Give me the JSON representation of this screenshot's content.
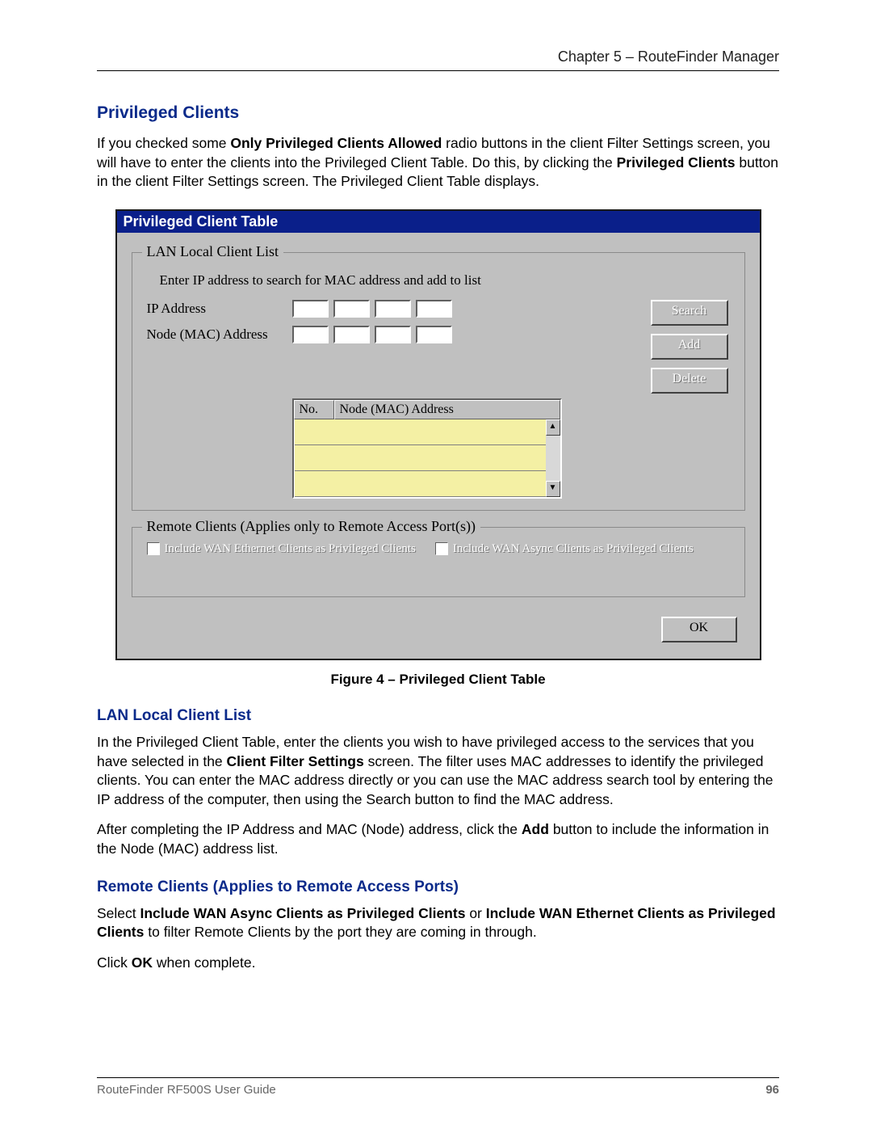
{
  "header": {
    "chapter": "Chapter 5 – RouteFinder Manager"
  },
  "section": {
    "title": "Privileged Clients",
    "intro_pre": "If you checked some ",
    "intro_bold1": "Only Privileged Clients Allowed",
    "intro_mid": " radio buttons in the client Filter Settings screen, you will have to enter the clients into the Privileged Client Table. Do this, by clicking the ",
    "intro_bold2": "Privileged Clients",
    "intro_post": " button in the client Filter Settings screen. The Privileged Client Table displays."
  },
  "dialog": {
    "title": "Privileged Client Table",
    "group_lan": {
      "legend": "LAN Local Client List",
      "instruction": "Enter IP address to search for MAC address and add to list",
      "ip_label": "IP Address",
      "mac_label": "Node (MAC) Address",
      "buttons": {
        "search": "Search",
        "add": "Add",
        "delete": "Delete"
      },
      "list_headers": {
        "no": "No.",
        "mac": "Node (MAC) Address"
      }
    },
    "group_remote": {
      "legend": "Remote Clients (Applies only to Remote Access Port(s))",
      "check_ethernet": "Include WAN Ethernet Clients as Privileged Clients",
      "check_async": "Include WAN Async Clients as Privileged Clients"
    },
    "ok": "OK"
  },
  "caption": "Figure 4 – Privileged Client Table",
  "lan_section": {
    "title": "LAN Local Client List",
    "p1_pre": "In the Privileged Client Table, enter the clients you wish to have privileged access to the services that you have selected in the ",
    "p1_bold": "Client Filter Settings",
    "p1_post": " screen. The filter uses MAC addresses to identify the privileged clients. You can enter the MAC address directly or you can use the MAC address search tool by entering the IP address of the computer, then using the Search button to find the MAC address.",
    "p2_pre": "After completing the IP Address and MAC (Node) address, click the ",
    "p2_bold": "Add",
    "p2_post": " button to include the information in the Node (MAC) address list."
  },
  "remote_section": {
    "title": "Remote Clients (Applies to Remote Access Ports)",
    "p_pre": "Select ",
    "p_bold1": "Include WAN Async Clients as Privileged Clients",
    "p_mid": " or ",
    "p_bold2": "Include WAN Ethernet Clients as Privileged Clients",
    "p_post": " to filter Remote Clients by the port they are coming in through.",
    "p_ok_pre": "Click ",
    "p_ok_bold": "OK",
    "p_ok_post": " when complete."
  },
  "footer": {
    "guide": "RouteFinder RF500S User Guide",
    "page": "96"
  }
}
